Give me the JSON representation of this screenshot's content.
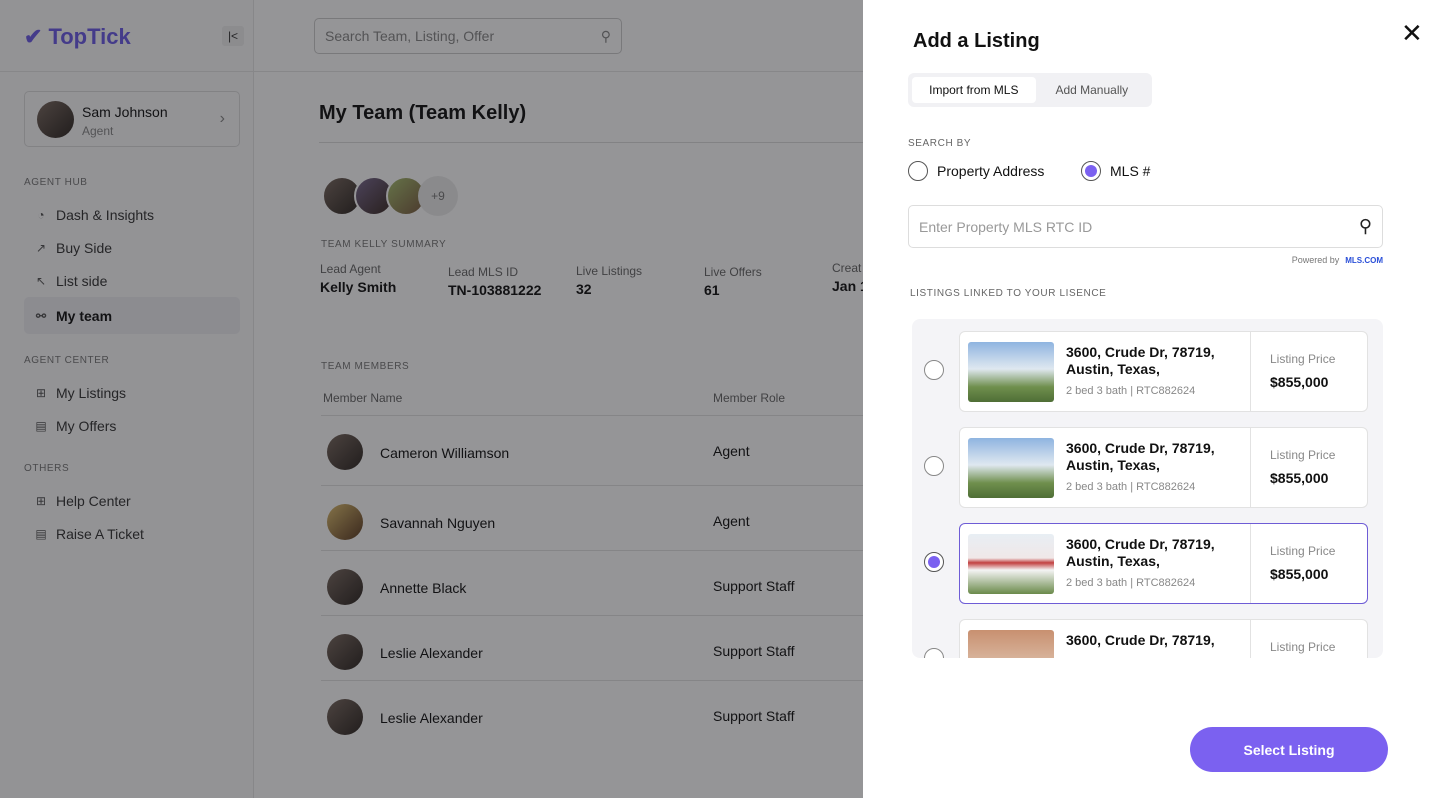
{
  "app": {
    "logo": "TopTick",
    "search_placeholder": "Search Team, Listing, Offer"
  },
  "user": {
    "name": "Sam Johnson",
    "role": "Agent"
  },
  "sidebar": {
    "sections": [
      {
        "title": "AGENT HUB",
        "items": [
          {
            "label": "Dash & Insights",
            "icon": "pie-chart-icon"
          },
          {
            "label": "Buy Side",
            "icon": "arrow-up-right-icon"
          },
          {
            "label": "List side",
            "icon": "arrow-up-left-icon"
          },
          {
            "label": "My team",
            "icon": "team-icon",
            "active": true
          }
        ]
      },
      {
        "title": "AGENT CENTER",
        "items": [
          {
            "label": "My Listings",
            "icon": "grid-icon"
          },
          {
            "label": "My Offers",
            "icon": "clipboard-icon"
          }
        ]
      },
      {
        "title": "OTHERS",
        "items": [
          {
            "label": "Help Center",
            "icon": "grid-icon"
          },
          {
            "label": "Raise A Ticket",
            "icon": "clipboard-icon"
          }
        ]
      }
    ]
  },
  "main": {
    "title": "My Team (Team Kelly)",
    "more_members": "+9",
    "summary_title": "TEAM KELLY SUMMARY",
    "stats": [
      {
        "label": "Lead Agent",
        "value": "Kelly Smith"
      },
      {
        "label": "Lead MLS ID",
        "value": "TN-103881222"
      },
      {
        "label": "Live Listings",
        "value": "32"
      },
      {
        "label": "Live Offers",
        "value": "61"
      },
      {
        "label": "Creat",
        "value": "Jan 1"
      }
    ],
    "members_title": "TEAM MEMBERS",
    "columns": [
      "Member Name",
      "Member Role"
    ],
    "members": [
      {
        "name": "Cameron Williamson",
        "role": "Agent"
      },
      {
        "name": "Savannah Nguyen",
        "role": "Agent"
      },
      {
        "name": "Annette Black",
        "role": "Support Staff"
      },
      {
        "name": "Leslie Alexander",
        "role": "Support Staff"
      },
      {
        "name": "Leslie Alexander",
        "role": "Support Staff"
      }
    ]
  },
  "modal": {
    "title": "Add a Listing",
    "tabs": [
      "Import from MLS",
      "Add Manually"
    ],
    "search_by": "SEARCH BY",
    "options": [
      "Property Address",
      "MLS #"
    ],
    "selected_option": "MLS #",
    "input_placeholder": "Enter Property MLS RTC ID",
    "powered_by": "Powered by",
    "powered_logo": "MLS.COM",
    "listings_title": "LISTINGS LINKED TO YOUR LISENCE",
    "listings": [
      {
        "address": "3600, Crude Dr, 78719, Austin, Texas,",
        "meta": "2 bed 3 bath | RTC882624",
        "price_label": "Listing Price",
        "price": "$855,000",
        "selected": false
      },
      {
        "address": "3600, Crude Dr, 78719, Austin, Texas,",
        "meta": "2 bed 3 bath | RTC882624",
        "price_label": "Listing Price",
        "price": "$855,000",
        "selected": false
      },
      {
        "address": "3600, Crude Dr, 78719, Austin, Texas,",
        "meta": "2 bed 3 bath | RTC882624",
        "price_label": "Listing Price",
        "price": "$855,000",
        "selected": true
      },
      {
        "address": "3600, Crude Dr, 78719,",
        "meta": "",
        "price_label": "Listing Price",
        "price": "",
        "selected": false
      }
    ],
    "submit": "Select Listing",
    "accent": "#7b61f0"
  }
}
